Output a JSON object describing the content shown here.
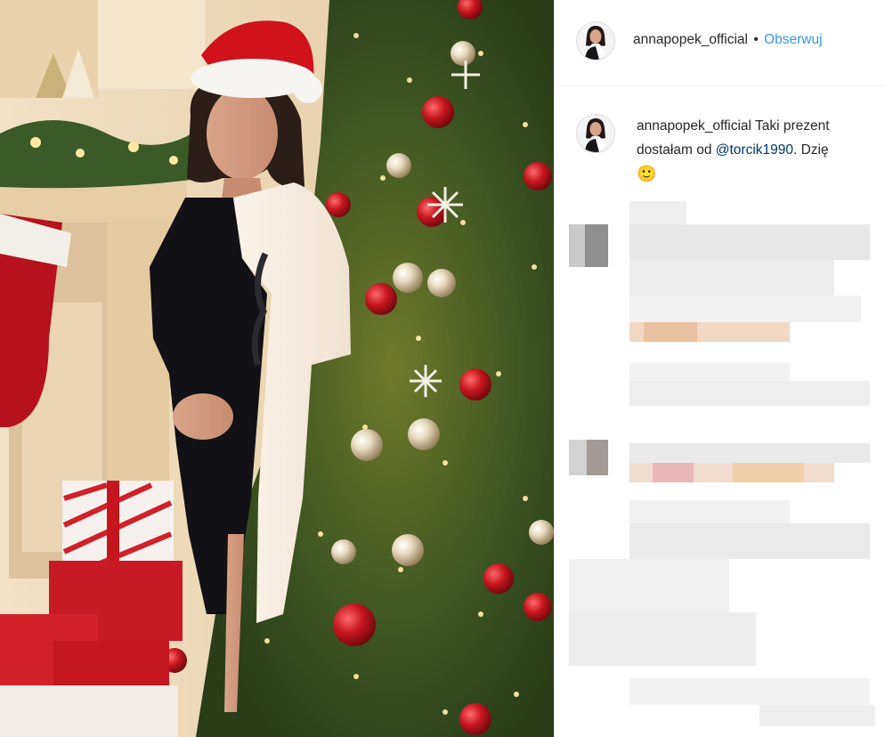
{
  "post": {
    "username": "annapopek_official",
    "separator": "•",
    "follow_label": "Obserwuj",
    "caption": {
      "username": "annapopek_official",
      "text_line1": " Taki prezent",
      "text_line2_prefix": "dostałam od ",
      "mention": "@torcik1990",
      "text_line2_suffix": ". Dzię",
      "emoji": "🙂"
    }
  },
  "colors": {
    "link_blue": "#3897f0",
    "mention_blue": "#003569",
    "text": "#262626"
  },
  "icons": {
    "avatar": "profile-photo",
    "emoji": "slightly-smiling-face"
  }
}
